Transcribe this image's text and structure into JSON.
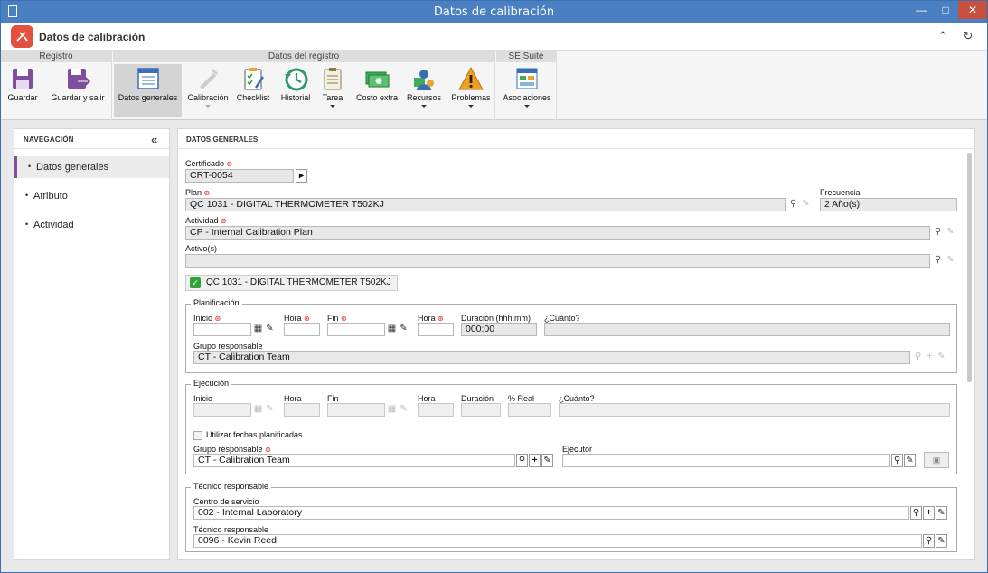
{
  "window": {
    "title": "Datos de calibración"
  },
  "header": {
    "title": "Datos de calibración"
  },
  "ribbon": {
    "groups": {
      "registro": "Registro",
      "datos_registro": "Datos del registro",
      "se_suite": "SE Suite"
    },
    "buttons": {
      "guardar": "Guardar",
      "guardar_salir": "Guardar y salir",
      "datos_generales": "Datos generales",
      "calibracion": "Calibración",
      "checklist": "Checklist",
      "historial": "Historial",
      "tarea": "Tarea",
      "costo_extra": "Costo extra",
      "recursos": "Recursos",
      "problemas": "Problemas",
      "asociaciones": "Asociaciones"
    }
  },
  "nav": {
    "title": "NAVEGACIÓN",
    "items": [
      "Datos generales",
      "Atributo",
      "Actividad"
    ]
  },
  "main": {
    "title": "DATOS GENERALES",
    "certificado": {
      "label": "Certificado",
      "value": "CRT-0054"
    },
    "plan": {
      "label": "Plan",
      "value": "QC 1031 - DIGITAL THERMOMETER T502KJ"
    },
    "frecuencia": {
      "label": "Frecuencia",
      "value": "2 Año(s)"
    },
    "actividad": {
      "label": "Actividad",
      "value": "CP - Internal Calibration Plan"
    },
    "activos": {
      "label": "Activo(s)",
      "value": ""
    },
    "chip": "QC 1031 - DIGITAL THERMOMETER T502KJ",
    "planificacion": {
      "legend": "Planificación",
      "inicio": "Inicio",
      "hora1": "Hora",
      "fin": "Fin",
      "hora2": "Hora",
      "duracion": "Duración (hhh:mm)",
      "duracion_value": "000:00",
      "cuanto": "¿Cuánto?",
      "grupo_label": "Grupo responsable",
      "grupo_value": "CT - Calibration Team"
    },
    "ejecucion": {
      "legend": "Ejecución",
      "inicio": "Inicio",
      "hora1": "Hora",
      "fin": "Fin",
      "hora2": "Hora",
      "duracion": "Duración",
      "real": "% Real",
      "cuanto": "¿Cuánto?",
      "utilizar": "Utilizar fechas planificadas",
      "grupo_label": "Grupo responsable",
      "grupo_value": "CT - Calibration Team",
      "ejecutor_label": "Ejecutor",
      "ejecutor_value": ""
    },
    "tecnico": {
      "legend": "Técnico responsable",
      "centro_label": "Centro de servicio",
      "centro_value": "002 - Internal Laboratory",
      "tecnico_label": "Técnico responsable",
      "tecnico_value": "0096 - Kevin Reed"
    }
  },
  "colors": {
    "titlebar": "#4a7fc1",
    "accent": "#7d4f9d",
    "logo": "#e2503f",
    "close": "#c7503f"
  }
}
